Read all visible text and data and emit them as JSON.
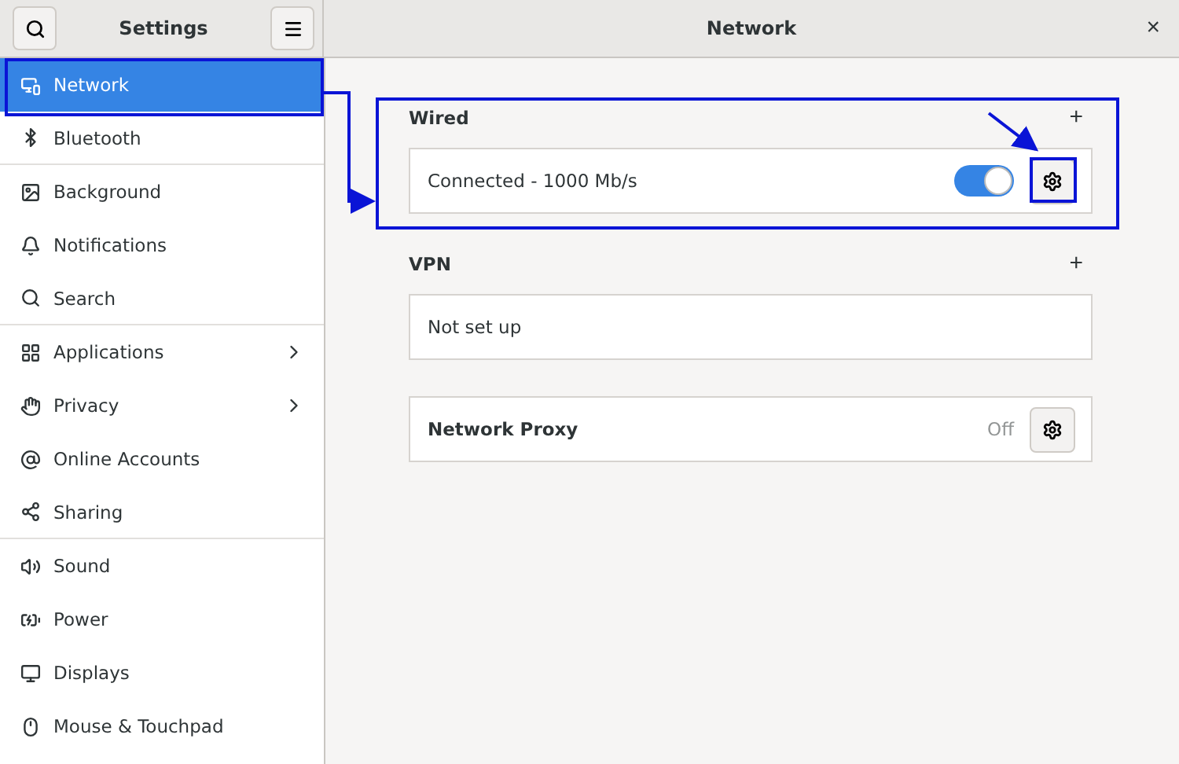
{
  "header": {
    "sidebar_title": "Settings",
    "title": "Network",
    "close": "×"
  },
  "sidebar": {
    "items": [
      {
        "label": "Network",
        "selected": true,
        "submenu": false,
        "divider_after": false
      },
      {
        "label": "Bluetooth",
        "selected": false,
        "submenu": false,
        "divider_after": true
      },
      {
        "label": "Background",
        "selected": false,
        "submenu": false,
        "divider_after": false
      },
      {
        "label": "Notifications",
        "selected": false,
        "submenu": false,
        "divider_after": false
      },
      {
        "label": "Search",
        "selected": false,
        "submenu": false,
        "divider_after": true
      },
      {
        "label": "Applications",
        "selected": false,
        "submenu": true,
        "divider_after": false
      },
      {
        "label": "Privacy",
        "selected": false,
        "submenu": true,
        "divider_after": false
      },
      {
        "label": "Online Accounts",
        "selected": false,
        "submenu": false,
        "divider_after": false
      },
      {
        "label": "Sharing",
        "selected": false,
        "submenu": false,
        "divider_after": true
      },
      {
        "label": "Sound",
        "selected": false,
        "submenu": false,
        "divider_after": false
      },
      {
        "label": "Power",
        "selected": false,
        "submenu": false,
        "divider_after": false
      },
      {
        "label": "Displays",
        "selected": false,
        "submenu": false,
        "divider_after": false
      },
      {
        "label": "Mouse & Touchpad",
        "selected": false,
        "submenu": false,
        "divider_after": false
      }
    ]
  },
  "sections": [
    {
      "title": "Wired",
      "add": "+",
      "rows": [
        {
          "kind": "connection",
          "label": "Connected - 1000 Mb/s",
          "on": true
        }
      ]
    },
    {
      "title": "VPN",
      "add": "+",
      "rows": [
        {
          "kind": "plain",
          "label": "Not set up"
        }
      ]
    },
    {
      "rows": [
        {
          "kind": "proxy",
          "label": "Network Proxy",
          "status": "Off"
        }
      ]
    }
  ]
}
